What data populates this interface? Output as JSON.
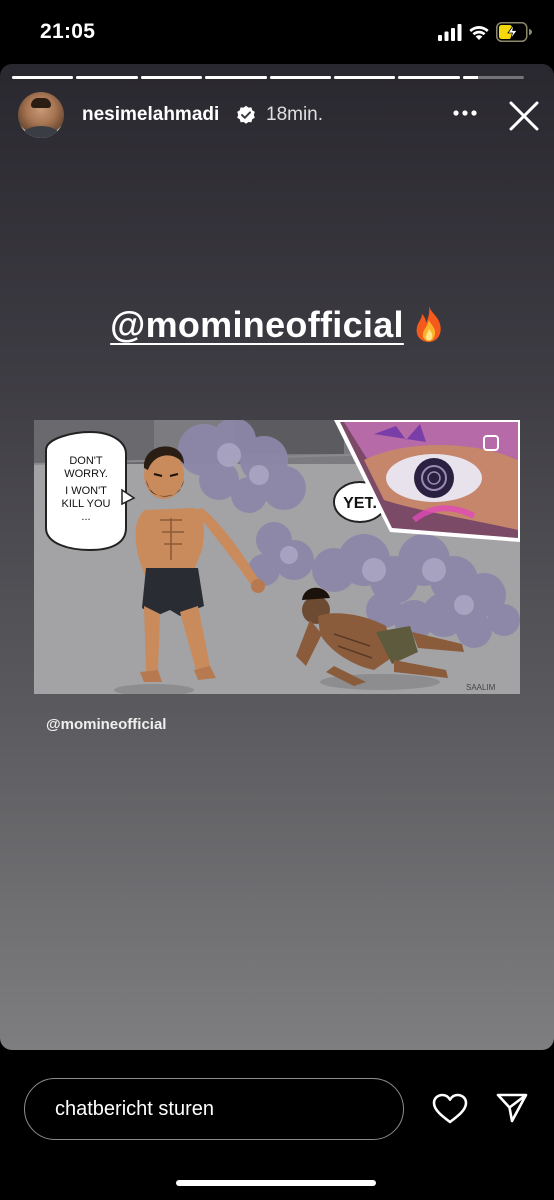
{
  "status_bar": {
    "time": "21:05",
    "signal_icon": "cellular-signal-icon",
    "wifi_icon": "wifi-icon",
    "battery_icon": "battery-charging-icon",
    "battery_color": "#f5d90a"
  },
  "story": {
    "progress": {
      "segment_count": 8,
      "completed_segments": 7,
      "current_segment_progress": 0.25
    },
    "header": {
      "username": "nesimelahmadi",
      "verified": true,
      "time_ago": "18min.",
      "more_icon": "more-horizontal-icon",
      "close_icon": "close-icon"
    },
    "mention_sticker": {
      "text": "@momineofficial",
      "emoji_icon": "fire-emoji-icon"
    },
    "shared_post": {
      "caption": "@momineofficial",
      "comic": {
        "speech_bubble_left": [
          "DON'T",
          "WORRY.",
          "I WON'T",
          "KILL YOU",
          "..."
        ],
        "speech_bubble_right": "YET.",
        "signature": "SAALIM"
      }
    }
  },
  "footer": {
    "message_placeholder": "chatbericht sturen",
    "like_icon": "heart-icon",
    "share_icon": "send-icon"
  },
  "colors": {
    "background": "#000000",
    "story_gradient_top": "#2a282f",
    "story_gradient_bottom": "#7e7e80",
    "text": "#ffffff"
  }
}
